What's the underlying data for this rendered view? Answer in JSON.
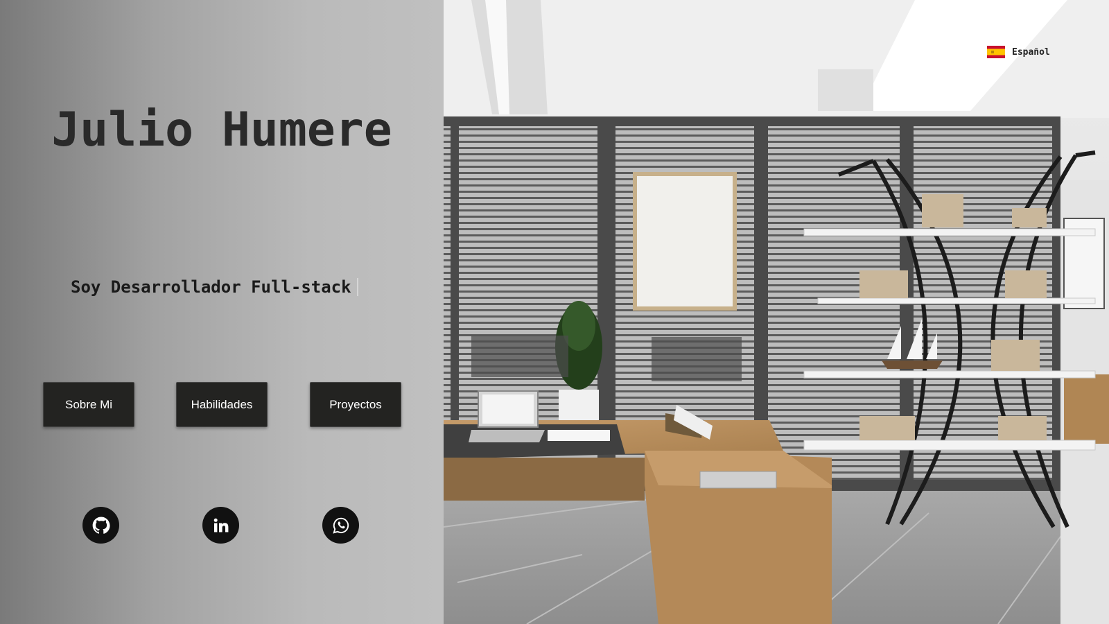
{
  "hero": {
    "name": "Julio Humere",
    "tagline": "Soy Desarrollador Full-stack"
  },
  "nav": {
    "buttons": [
      {
        "label": "Sobre Mi"
      },
      {
        "label": "Habilidades"
      },
      {
        "label": "Proyectos"
      }
    ]
  },
  "social": [
    {
      "icon": "github-icon"
    },
    {
      "icon": "linkedin-icon"
    },
    {
      "icon": "whatsapp-icon"
    }
  ],
  "language": {
    "label": "Español",
    "flag": "spain-flag-icon"
  },
  "colors": {
    "button_bg": "#232321",
    "button_text": "#ffffff",
    "social_bg": "#111111",
    "name_text": "#2a2a2a"
  }
}
